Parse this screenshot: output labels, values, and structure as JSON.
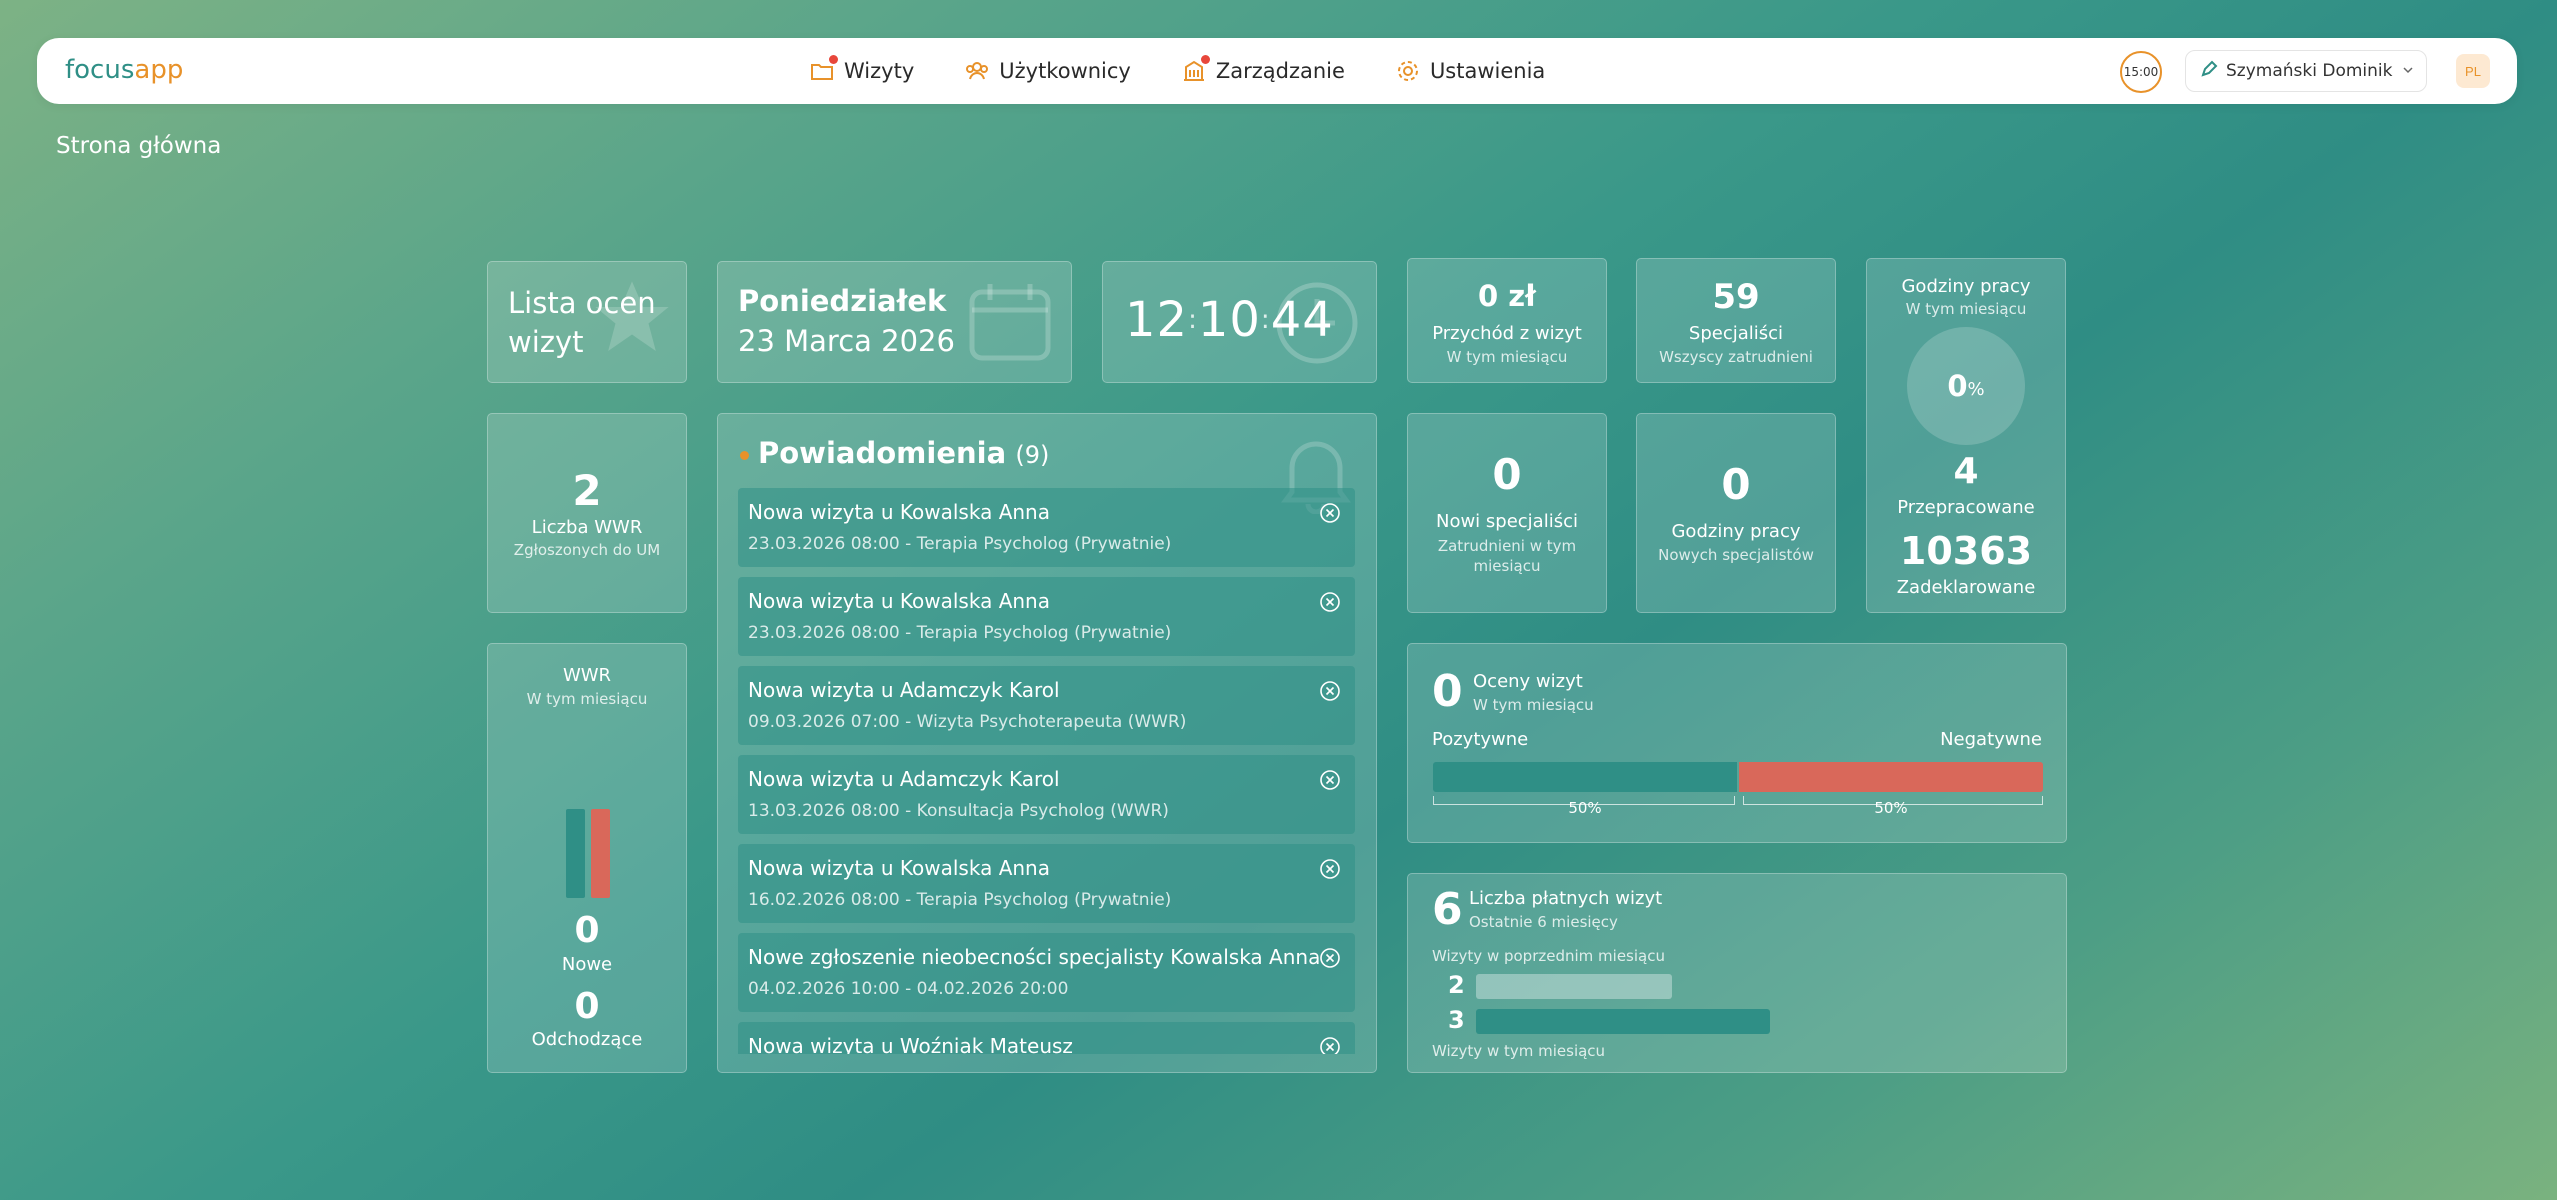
{
  "header": {
    "logo_a": "focus",
    "logo_b": "app",
    "nav": [
      {
        "label": "Wizyty",
        "icon": "folder-icon",
        "badge": true
      },
      {
        "label": "Użytkownicy",
        "icon": "users-icon",
        "badge": false
      },
      {
        "label": "Zarządzanie",
        "icon": "building-icon",
        "badge": true
      },
      {
        "label": "Ustawienia",
        "icon": "gear-icon",
        "badge": false
      }
    ],
    "time_badge": "15:00",
    "user_name": "Szymański Dominik",
    "lang": "PL"
  },
  "breadcrumb": "Strona główna",
  "ratings_list": {
    "label": "Lista ocen wizyt"
  },
  "date_card": {
    "day": "Poniedziałek",
    "date": "23 Marca 2026"
  },
  "clock": {
    "h": "12",
    "m": "10",
    "s": "44"
  },
  "revenue": {
    "value": "0 zł",
    "label": "Przychód z wizyt",
    "sub": "W tym miesiącu"
  },
  "specialists": {
    "value": "59",
    "label": "Specjaliści",
    "sub": "Wszyscy zatrudnieni"
  },
  "work_hours": {
    "title": "Godziny pracy",
    "sub": "W tym miesiącu",
    "percent": "0",
    "percent_sign": "%",
    "worked": "4",
    "worked_label": "Przepracowane",
    "declared": "10363",
    "declared_label": "Zadeklarowane"
  },
  "wwr_count": {
    "value": "2",
    "label": "Liczba WWR",
    "sub": "Zgłoszonych do UM"
  },
  "new_specialists": {
    "value": "0",
    "label": "Nowi specjaliści",
    "sub": "Zatrudnieni w tym miesiącu"
  },
  "new_hours": {
    "value": "0",
    "label": "Godziny pracy",
    "sub": "Nowych specjalistów"
  },
  "wwr_month": {
    "title": "WWR",
    "sub": "W tym miesiącu",
    "new_value": "0",
    "new_label": "Nowe",
    "leaving_value": "0",
    "leaving_label": "Odchodzące",
    "colors": {
      "new": "#2f8f86",
      "leaving": "#d9685a"
    }
  },
  "notifications": {
    "title": "Powiadomienia",
    "count": "(9)",
    "items": [
      {
        "title": "Nowa wizyta u Kowalska Anna",
        "detail": "23.03.2026 08:00 - Terapia Psycholog (Prywatnie)"
      },
      {
        "title": "Nowa wizyta u Kowalska Anna",
        "detail": "23.03.2026 08:00 - Terapia Psycholog (Prywatnie)"
      },
      {
        "title": "Nowa wizyta u Adamczyk Karol",
        "detail": "09.03.2026 07:00 - Wizyta Psychoterapeuta (WWR)"
      },
      {
        "title": "Nowa wizyta u Adamczyk Karol",
        "detail": "13.03.2026 08:00 - Konsultacja Psycholog (WWR)"
      },
      {
        "title": "Nowa wizyta u Kowalska Anna",
        "detail": "16.02.2026 08:00 - Terapia Psycholog (Prywatnie)"
      },
      {
        "title": "Nowe zgłoszenie nieobecności specjalisty Kowalska Anna",
        "detail": "04.02.2026 10:00 - 04.02.2026 20:00"
      },
      {
        "title": "Nowa wizyta u Woźniak Mateusz",
        "detail": ""
      }
    ]
  },
  "ratings": {
    "value": "0",
    "title": "Oceny wizyt",
    "sub": "W tym miesiącu",
    "positive_label": "Pozytywne",
    "negative_label": "Negatywne",
    "positive_pct_value": 50,
    "negative_pct_value": 50,
    "positive_pct": "50%",
    "negative_pct": "50%",
    "colors": {
      "positive": "#2f8f86",
      "negative": "#d9685a"
    }
  },
  "paid": {
    "value": "6",
    "title": "Liczba płatnych wizyt",
    "sub": "Ostatnie 6 miesięcy",
    "prev_label": "Wizyty w poprzednim miesiącu",
    "prev_value": 2,
    "prev_value_label": "2",
    "cur_value": 3,
    "cur_value_label": "3",
    "cur_label": "Wizyty w tym miesiącu",
    "colors": {
      "prev": "rgba(255,255,255,0.35)",
      "cur": "#2f8f86"
    }
  }
}
